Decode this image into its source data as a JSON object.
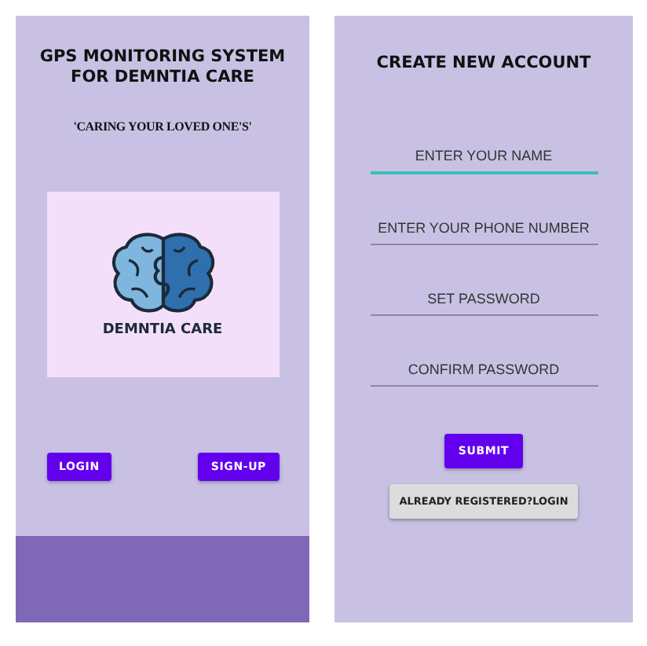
{
  "screens": [
    {
      "kind": "welcome",
      "title": "GPS MONITORING SYSTEM FOR DEMNTIA CARE",
      "tagline": "'CARING YOUR LOVED ONE'S'",
      "logo_text": "DEMNTIA CARE",
      "buttons": [
        "LOGIN",
        "SIGN-UP"
      ]
    },
    {
      "kind": "signup",
      "title": "CREATE NEW ACCOUNT",
      "fields": [
        {
          "placeholder": "ENTER YOUR NAME",
          "focused": true
        },
        {
          "placeholder": "ENTER YOUR PHONE NUMBER",
          "focused": false
        },
        {
          "placeholder": "SET PASSWORD",
          "focused": false
        },
        {
          "placeholder": "CONFIRM PASSWORD",
          "focused": false
        }
      ],
      "submit": "SUBMIT",
      "login_link": "ALREADY REGISTERED?LOGIN"
    }
  ]
}
